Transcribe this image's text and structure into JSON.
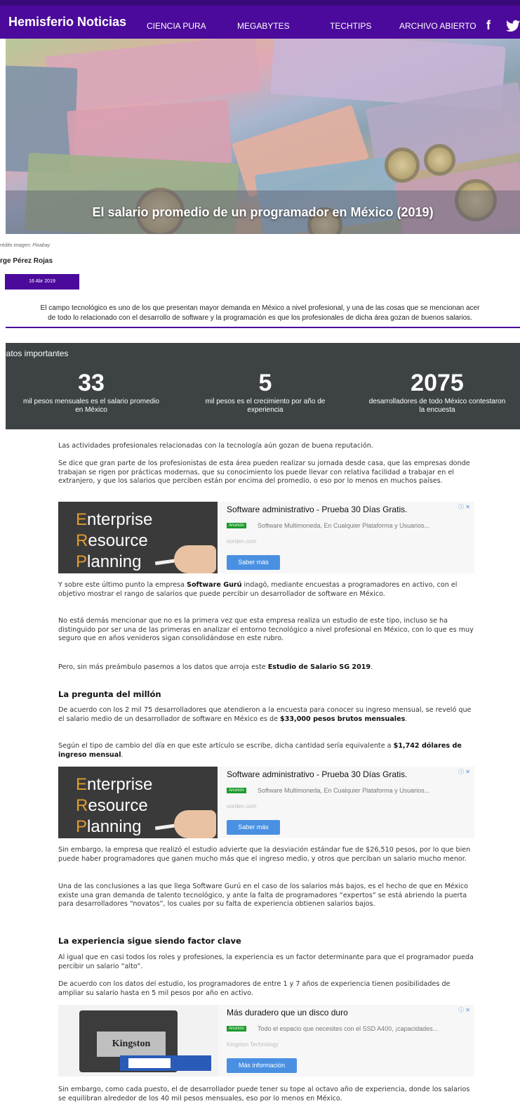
{
  "nav": {
    "brand": "Hemisferio Noticias",
    "links": [
      "CIENCIA PURA",
      "MEGABYTES",
      "TECHTIPS",
      "ARCHIVO ABIERTO"
    ],
    "facebook": "f",
    "twitter": "ᵯ"
  },
  "hero": {
    "title": "El salario promedio de un programador en México (2019)"
  },
  "article": {
    "caption": "rédito imagen: Pixabay",
    "author": "rge Pérez Rojas",
    "date": "16 Abr 2019",
    "intro_line1": "El campo tecnológico es uno de los que presentan mayor demanda en México a nivel profesional, y una de las cosas que se mencionan acer",
    "intro_line2": "de todo lo relacionado con el desarrollo de software y la programación es que los profesionales de dicha área gozan de buenos salarios."
  },
  "stats": {
    "title": "Datos importantes",
    "items": [
      {
        "value": "33",
        "label": "mil pesos mensuales es el salario promedio en México"
      },
      {
        "value": "5",
        "label": "mil pesos es el crecimiento por año de experiencia"
      },
      {
        "value": "2075",
        "label": "desarrolladores de todo México contestaron la encuesta"
      }
    ]
  },
  "body": {
    "p1": "Las actividades profesionales relacionadas con la tecnología aún gozan de buena reputación.",
    "p2": "Se dice que gran parte de los profesionistas de esta área pueden realizar su jornada desde casa, que las empresas donde trabajan se rigen por prácticas modernas, que su conocimiento los puede llevar con relativa facilidad a trabajar en el extranjero, y que los salarios que perciben están por encima del promedio, o eso por lo menos en muchos países.",
    "p3_a": "Y sobre este último punto la empresa ",
    "p3_b": "Software Gurú",
    "p3_c": " indagó, mediante encuestas a programadores en activo, con el objetivo mostrar el rango de salarios que puede percibir un desarrollador de software en México.",
    "p4": "No está demás mencionar que no es la primera vez que esta empresa realiza un estudio de este tipo, incluso se ha distinguido por ser una de las primeras en analizar el entorno tecnológico a nivel profesional en México, con lo que es muy seguro que en años venideros sigan consolidándose en este rubro.",
    "p5_a": "Pero, sin más preámbulo pasemos a los datos que arroja este ",
    "p5_b": "Estudio de Salario SG 2019",
    "p5_c": ".",
    "h1": "La pregunta del millón",
    "p6_a": "De acuerdo con los 2 mil 75 desarrolladores que atendieron a la encuesta para conocer su ingreso mensual, se reveló que el salario medio de un desarrollador de software en México es de ",
    "p6_b": "$33,000 pesos brutos mensuales",
    "p6_c": ".",
    "p7_a": "Según el tipo de cambio del día en que este artículo se escribe, dicha cantidad sería equivalente a ",
    "p7_b": "$1,742 dólares de ingreso mensual",
    "p7_c": ".",
    "p8": "Sin embargo, la empresa que realizó el estudio advierte que la desviación estándar fue de $26,510 pesos, por lo que bien puede haber programadores que ganen mucho más que el ingreso medio, y otros que perciban un salario mucho menor.",
    "p9": "Una de las conclusiones a las que llega Software Gurú en el caso de los salarios más bajos, es el hecho de que en México existe una gran demanda de talento tecnológico, y ante la falta de programadores “expertos” se está abriendo la puerta para desarrolladores “novatos”, los cuales por su falta de experiencia obtienen salarios bajos.",
    "h2": "La experiencia sigue siendo factor clave",
    "p10": "Al igual que en casi todos los roles y profesiones, la experiencia es un factor determinante para que el programador pueda percibir un salario “alto”.",
    "p11": "De acuerdo con los datos del estudio, los programadores de entre 1 y 7 años de experiencia tienen posibilidades de ampliar su salario hasta en 5 mil pesos por año en activo.",
    "p12": "Sin embargo, como cada puesto, el de desarrollador puede tener su tope al octavo año de experiencia, donde los salarios se equilibran alrededor de los 40 mil pesos mensuales, eso por lo menos en México."
  },
  "ads": {
    "erp": {
      "img_lines": [
        "Enterprise",
        "Resource",
        "Planning"
      ],
      "title": "Software administrativo - Prueba 30 Días Gratis.",
      "badge": "Anuncio",
      "desc": "Software Multimoneda, En Cualquier Plataforma y Usuarios...",
      "domain": "oorden.com",
      "button": "Saber más",
      "corner": "ⓘ ✕"
    },
    "ssd": {
      "brand": "Kingston",
      "title": "Más duradero que un disco duro",
      "badge": "Anuncio",
      "desc": "Todo el espacio que necesites con el SSD A400, ¡capacidades...",
      "domain": "Kingston Technology",
      "button": "Más información",
      "corner": "ⓘ ✕"
    }
  }
}
